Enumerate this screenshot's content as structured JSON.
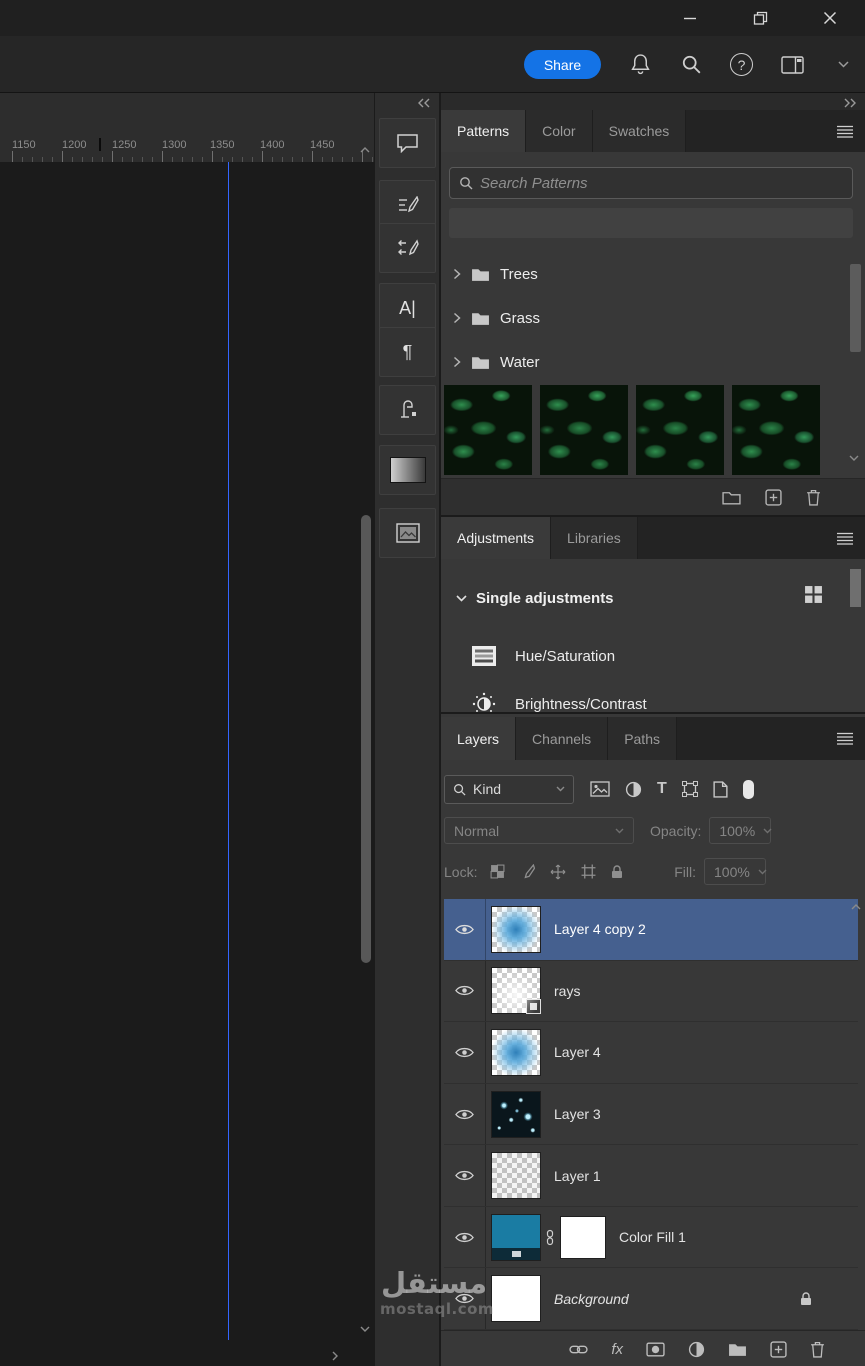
{
  "topbar": {
    "share_label": "Share"
  },
  "icons": {
    "character_glyph": "A|",
    "paragraph_glyph": "¶",
    "fx_glyph": "fx",
    "help_glyph": "?",
    "type_glyph": "T"
  },
  "canvas": {
    "ruler_ticks": [
      "1150",
      "1200",
      "1250",
      "1300",
      "1350",
      "1400",
      "1450"
    ]
  },
  "patterns_panel": {
    "tabs": {
      "patterns": "Patterns",
      "color": "Color",
      "swatches": "Swatches"
    },
    "search_placeholder": "Search Patterns",
    "folders": {
      "trees": "Trees",
      "grass": "Grass",
      "water": "Water"
    }
  },
  "adjustments_panel": {
    "tabs": {
      "adjustments": "Adjustments",
      "libraries": "Libraries"
    },
    "section_label": "Single adjustments",
    "items": {
      "hue_saturation": "Hue/Saturation",
      "brightness_contrast": "Brightness/Contrast"
    }
  },
  "layers_panel": {
    "tabs": {
      "layers": "Layers",
      "channels": "Channels",
      "paths": "Paths"
    },
    "filter_kind_label": "Kind",
    "blend_mode": "Normal",
    "opacity_label": "Opacity:",
    "opacity_value": "100%",
    "lock_label": "Lock:",
    "fill_label": "Fill:",
    "fill_value": "100%",
    "layers": [
      {
        "name": "Layer 4 copy 2",
        "selected": true
      },
      {
        "name": "rays"
      },
      {
        "name": "Layer 4"
      },
      {
        "name": "Layer 3"
      },
      {
        "name": "Layer 1"
      },
      {
        "name": "Color Fill 1"
      },
      {
        "name": "Background",
        "locked": true
      }
    ]
  },
  "watermark": {
    "line1": "مستقل",
    "line2": "mostaql.com"
  },
  "colors": {
    "accent_blue": "#1473e6",
    "selection_blue": "#45608f",
    "guide_blue": "#3466ff",
    "panel_bg": "#383838"
  }
}
